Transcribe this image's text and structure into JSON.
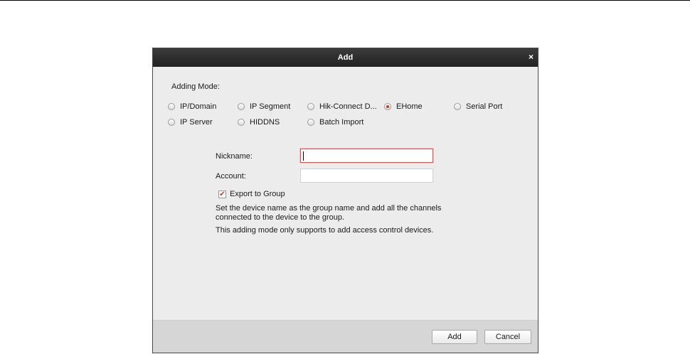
{
  "dialog": {
    "title": "Add",
    "close_glyph": "×",
    "close_icon": "close-icon",
    "adding_mode_label": "Adding Mode:",
    "modes": [
      {
        "label": "IP/Domain",
        "selected": false
      },
      {
        "label": "IP Segment",
        "selected": false
      },
      {
        "label": "Hik-Connect D...",
        "selected": false
      },
      {
        "label": "EHome",
        "selected": true
      },
      {
        "label": "Serial Port",
        "selected": false
      },
      {
        "label": "IP Server",
        "selected": false
      },
      {
        "label": "HIDDNS",
        "selected": false
      },
      {
        "label": "Batch Import",
        "selected": false
      }
    ],
    "nickname_label": "Nickname:",
    "nickname_value": "",
    "account_label": "Account:",
    "account_value": "",
    "export_group_label": "Export to Group",
    "export_group_checked": true,
    "check_glyph": "✔",
    "desc_1": "Set the device name as the group name and add all the channels connected to the device to the group.",
    "desc_2": "This adding mode only supports to add access control devices.",
    "add_button": "Add",
    "cancel_button": "Cancel"
  },
  "colors": {
    "titlebar": "#2a2a2a",
    "accent_red": "#c0392b",
    "dialog_bg": "#ececec",
    "footer_bg": "#d6d6d6"
  }
}
